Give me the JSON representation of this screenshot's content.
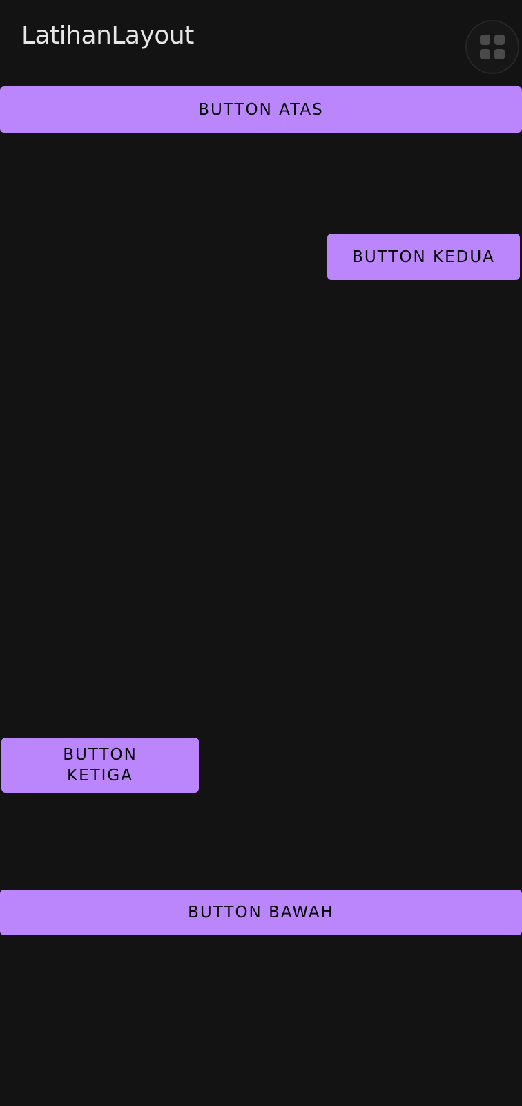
{
  "app": {
    "title": "LatihanLayout"
  },
  "header": {
    "switcher_icon": "apps-grid-icon"
  },
  "buttons": {
    "atas": "Button Atas",
    "kedua": "Button Kedua",
    "ketiga": "Button Ketiga",
    "bawah": "Button Bawah"
  },
  "colors": {
    "background": "#131313",
    "button": "#bb86fc",
    "button_text": "#000000",
    "title_text": "#e6e6e6"
  }
}
